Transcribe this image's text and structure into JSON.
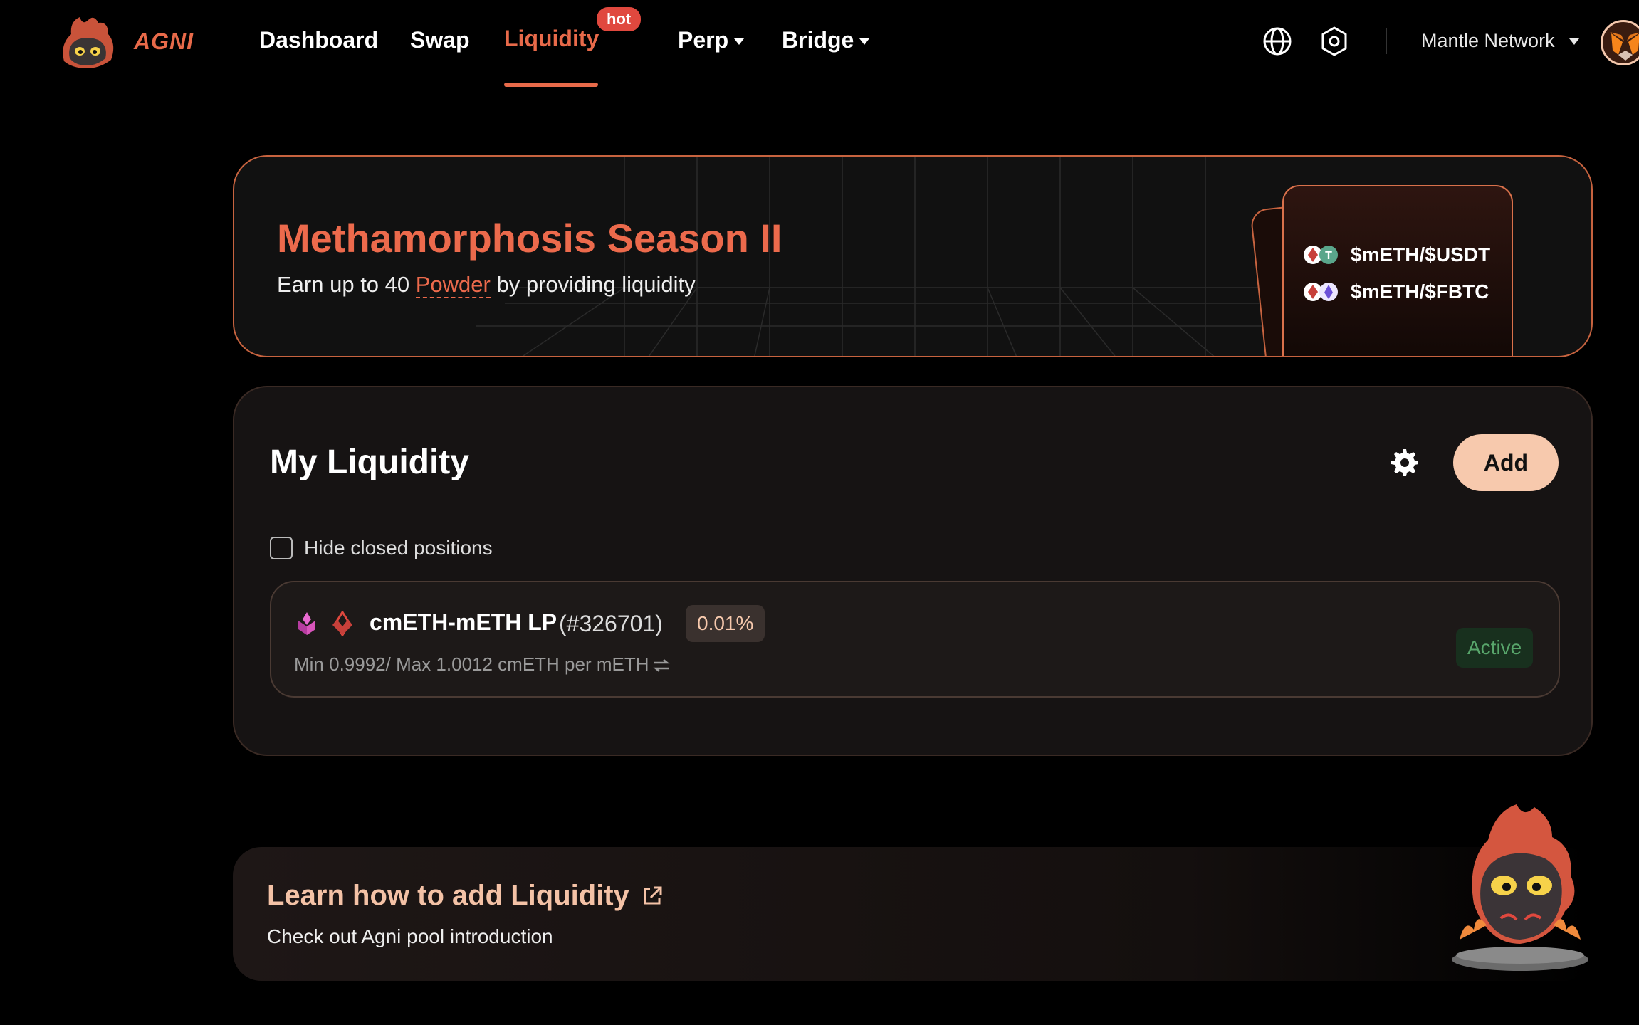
{
  "app": {
    "brand": "AGNI"
  },
  "nav": {
    "dashboard": "Dashboard",
    "swap": "Swap",
    "liquidity": "Liquidity",
    "hot_badge": "hot",
    "perp": "Perp",
    "bridge": "Bridge",
    "network": "Mantle Network"
  },
  "banner": {
    "title": "Methamorphosis Season II",
    "subtitle_prefix": "Earn up to 40 ",
    "subtitle_link": "Powder",
    "subtitle_suffix": " by providing liquidity",
    "pairs": [
      "$mETH/$USDT",
      "$mETH/$FBTC"
    ]
  },
  "liquidity": {
    "title": "My Liquidity",
    "add_label": "Add",
    "hide_closed_label": "Hide closed positions",
    "positions": [
      {
        "name": "cmETH-mETH LP",
        "id": "(#326701)",
        "fee": "0.01%",
        "range": "Min 0.9992/ Max 1.0012 cmETH per mETH",
        "status": "Active"
      }
    ]
  },
  "learn": {
    "title": "Learn how to add Liquidity",
    "subtitle": "Check out Agni pool introduction"
  },
  "colors": {
    "accent": "#e86a4a",
    "add_button": "#f7c9ad",
    "status_active": "#58a66b"
  },
  "icons": [
    "agni-logo-icon",
    "globe-icon",
    "settings-hex-icon",
    "metamask-icon",
    "gear-icon",
    "external-link-icon",
    "swap-arrows-icon",
    "cmeth-token-icon",
    "meth-token-icon",
    "usdt-token-icon",
    "fbtc-token-icon"
  ]
}
